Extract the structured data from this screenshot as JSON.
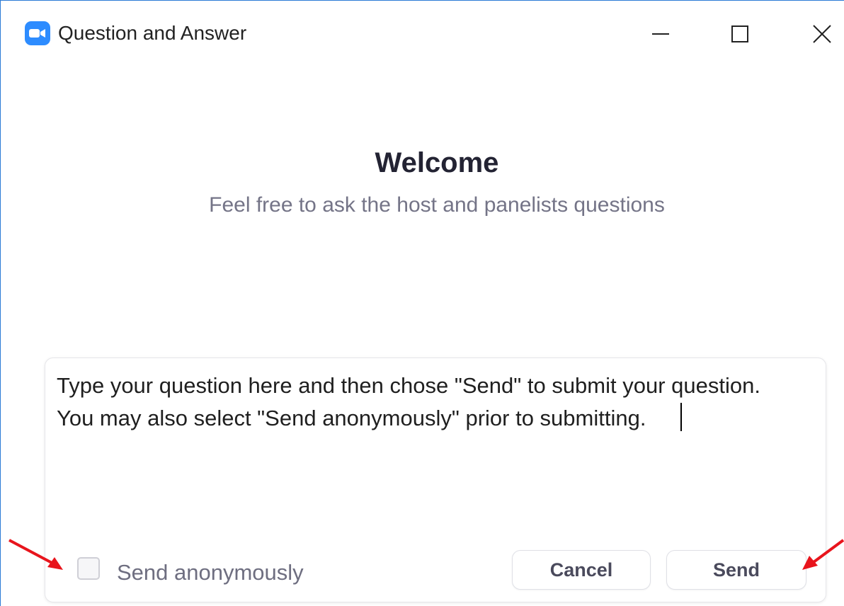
{
  "window": {
    "title": "Question and Answer"
  },
  "welcome": {
    "title": "Welcome",
    "subtitle": "Feel free to ask the host and panelists questions"
  },
  "question": {
    "value": "Type your question here and then chose \"Send\" to submit your question.\nYou may also select \"Send anonymously\" prior to submitting."
  },
  "footer": {
    "anonymous_label": "Send anonymously",
    "cancel_label": "Cancel",
    "send_label": "Send"
  },
  "colors": {
    "brand": "#2d8cff",
    "annotation_arrow": "#e8141c"
  },
  "icons": {
    "app": "zoom-camera-icon",
    "minimize": "minimize-icon",
    "maximize": "maximize-icon",
    "close": "close-icon"
  }
}
